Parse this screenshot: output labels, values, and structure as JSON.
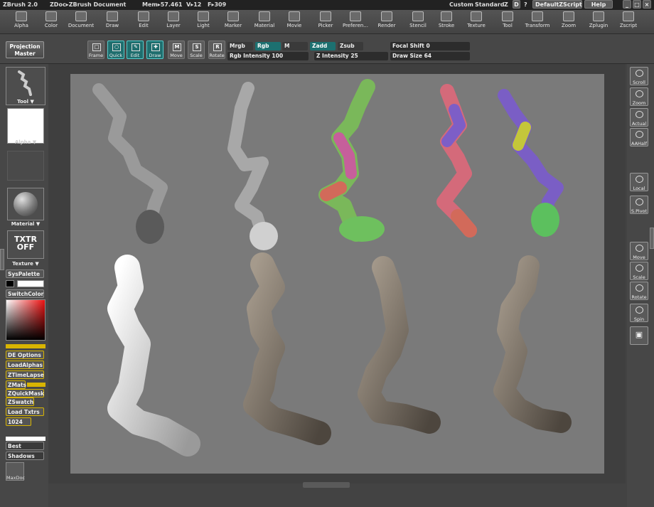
{
  "titlebar": {
    "app": "ZBrush 2.0",
    "doc": "ZDoc▸ZBrush Document",
    "mem": "Mem▸57.461",
    "v": "V▸12",
    "f": "F▸309",
    "layout": "Custom",
    "standard": "Standard",
    "z": "Z",
    "d": "D",
    "q": "?",
    "script": "DefaultZScript",
    "help": "Help"
  },
  "menu": [
    "Alpha",
    "Color",
    "Document",
    "Draw",
    "Edit",
    "Layer",
    "Light",
    "Marker",
    "Material",
    "Movie",
    "Picker",
    "Preferen...",
    "Render",
    "Stencil",
    "Stroke",
    "Texture",
    "Tool",
    "Transform",
    "Zoom",
    "Zplugin",
    "Zscript"
  ],
  "shelf": {
    "projection_master": [
      "Projection",
      "Master"
    ],
    "buttons": {
      "frame": "Frame",
      "quick": "Quick",
      "edit": "Edit",
      "draw": "Draw",
      "move": "Move",
      "scale": "Scale",
      "rotate": "Rotate"
    },
    "mrgb": "Mrgb",
    "rgb": "Rgb",
    "m": "M",
    "zadd": "Zadd",
    "zsub": "Zsub",
    "rgb_intensity_label": "Rgb Intensity",
    "rgb_intensity": "100",
    "z_intensity_label": "Z Intensity",
    "z_intensity": "25",
    "focal_shift_label": "Focal Shift",
    "focal_shift": "0",
    "draw_size_label": "Draw Size",
    "draw_size": "64"
  },
  "left": {
    "tool": "Tool",
    "alpha": "Alpha",
    "material": "Material",
    "txtr": [
      "TXTR",
      "OFF"
    ],
    "texture": "Texture",
    "syspalette": "SysPalette",
    "switchcolor": "SwitchColor",
    "buttons": [
      "DE Options",
      "LoadAlphas",
      "ZTimeLapse",
      "ZMats",
      "ZQuickMask",
      "ZSwatch",
      "Load Txtrs",
      "1024"
    ],
    "best": "Best",
    "shadows": "Shadows",
    "maxdoc": "MaxDoc"
  },
  "right": [
    "Scroll",
    "Zoom",
    "Actual",
    "AAHalf",
    "Local",
    "S.Pivot",
    "Move",
    "Scale",
    "Rotate",
    "Spin"
  ],
  "colors": {
    "accent": "#1f6e6e",
    "yellow": "#d8b400",
    "canvas": "#7a7a7a"
  }
}
